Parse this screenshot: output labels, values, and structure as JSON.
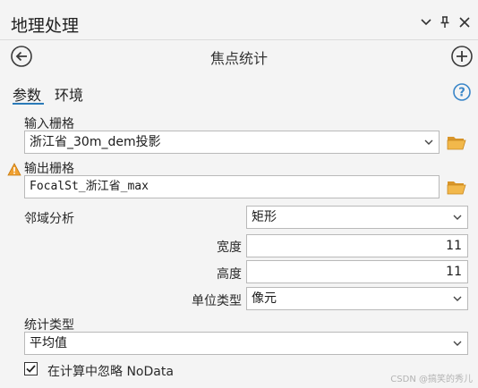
{
  "pane": {
    "title": "地理处理"
  },
  "tool": {
    "title": "焦点统计"
  },
  "tabs": [
    {
      "label": "参数",
      "active": true
    },
    {
      "label": "环境",
      "active": false
    }
  ],
  "params": {
    "input_raster": {
      "label": "输入栅格",
      "value": "浙江省_30m_dem投影"
    },
    "output_raster": {
      "label": "输出栅格",
      "value": "FocalSt_浙江省_max",
      "warning": true
    },
    "neighborhood": {
      "label": "邻域分析",
      "value": "矩形",
      "width_label": "宽度",
      "width_value": "11",
      "height_label": "高度",
      "height_value": "11",
      "unit_label": "单位类型",
      "unit_value": "像元"
    },
    "statistics_type": {
      "label": "统计类型",
      "value": "平均值"
    },
    "ignore_nodata": {
      "label": "在计算中忽略 NoData",
      "checked": true
    }
  },
  "watermark": "CSDN @搞笑的秀儿",
  "colors": {
    "accent": "#2a7ab8",
    "folder": "#e2a73c",
    "warning": "#f0a030",
    "help": "#3a86c8"
  }
}
